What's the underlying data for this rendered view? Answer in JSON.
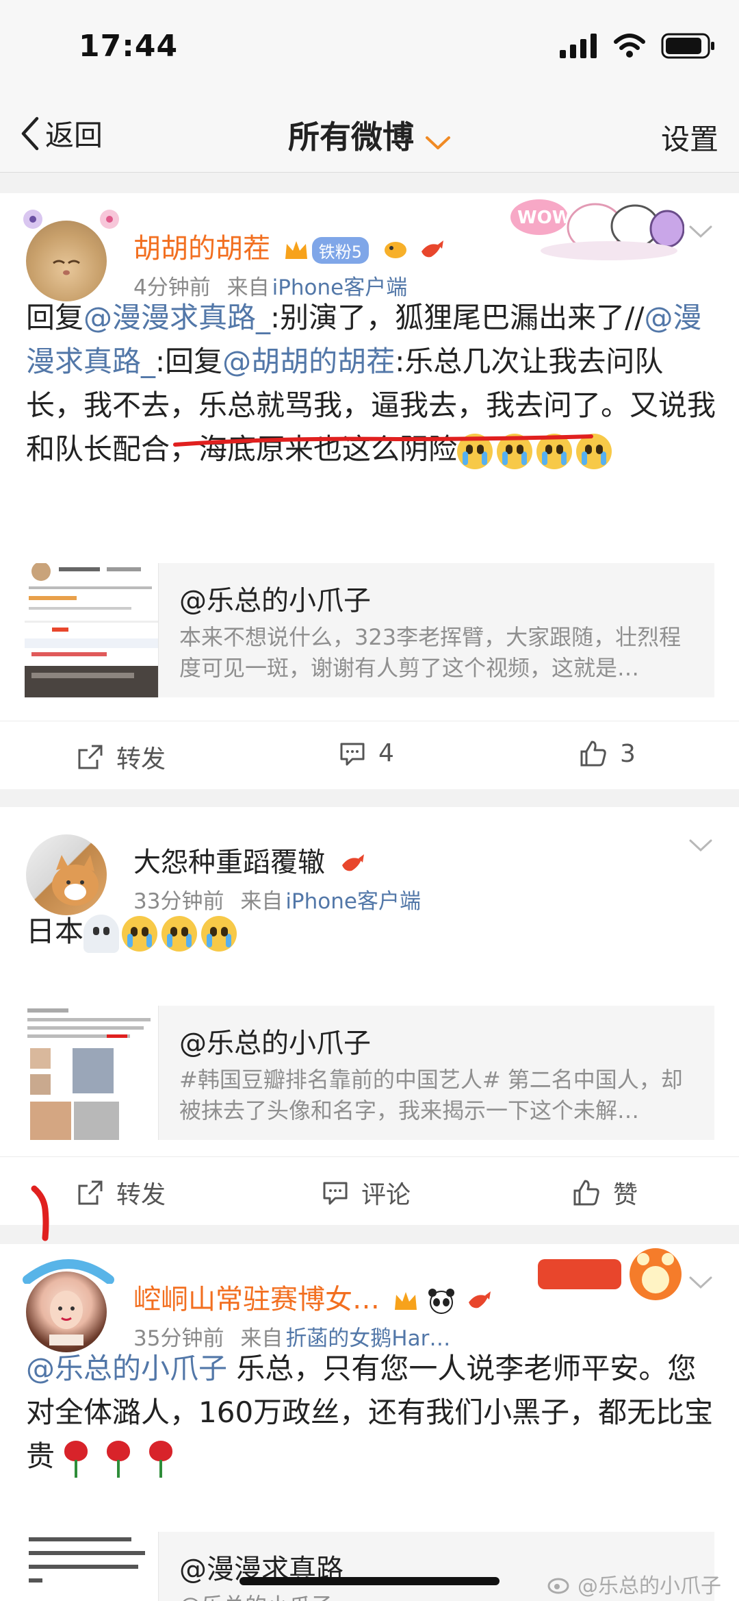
{
  "status": {
    "time": "17:44"
  },
  "nav": {
    "back": "返回",
    "title": "所有微博",
    "settings": "设置"
  },
  "posts": [
    {
      "user": "胡胡的胡茬",
      "fan_badge": "铁粉5",
      "time": "4分钟前",
      "from": "来自",
      "source": "iPhone客户端",
      "text": {
        "p1": "回复",
        "m1": "@漫漫求真路_",
        "p2": ":别演了，狐狸尾巴漏出来了//",
        "m2": "@漫漫求真路_",
        "p3": ":回复",
        "m3": "@胡胡的胡茬",
        "p4": ":乐总几次让我去问队长，",
        "u1": "我不去，乐总就骂我，逼我去",
        "p5": "，我去问了。又说我和队长配合，海底原来也这么阴险"
      },
      "quote": {
        "name": "@乐总的小爪子",
        "text": "本来不想说什么，323李老挥臂，大家跟随，壮烈程度可见一斑，谢谢有人剪了这个视频，这就是…"
      },
      "actions": {
        "repost": "转发",
        "comment": "4",
        "like": "3"
      }
    },
    {
      "user": "大怨种重蹈覆辙",
      "time": "33分钟前",
      "from": "来自",
      "source": "iPhone客户端",
      "text": {
        "p1": "日本"
      },
      "quote": {
        "name": "@乐总的小爪子",
        "text": "#韩国豆瓣排名靠前的中国艺人# 第二名中国人，却被抹去了头像和名字，我来揭示一下这个未解…"
      },
      "actions": {
        "repost": "转发",
        "comment": "评论",
        "like": "赞"
      }
    },
    {
      "user": "崆峒山常驻赛博女…",
      "time": "35分钟前",
      "from": "来自",
      "source": "折菡的女鹅Har…",
      "text": {
        "m1": "@乐总的小爪子",
        "p1": " 乐总，只有您一人说李老师平安。您对全体潞人，160万政丝，还有我们小黑子，都无比宝贵"
      },
      "quote": {
        "name": "@漫漫求真路_",
        "text": "@乐总的小爪子"
      }
    }
  ],
  "watermark": "@乐总的小爪子",
  "colors": {
    "vip_name": "#f26f20",
    "link": "#5277a8",
    "annotation": "#e0201f"
  }
}
